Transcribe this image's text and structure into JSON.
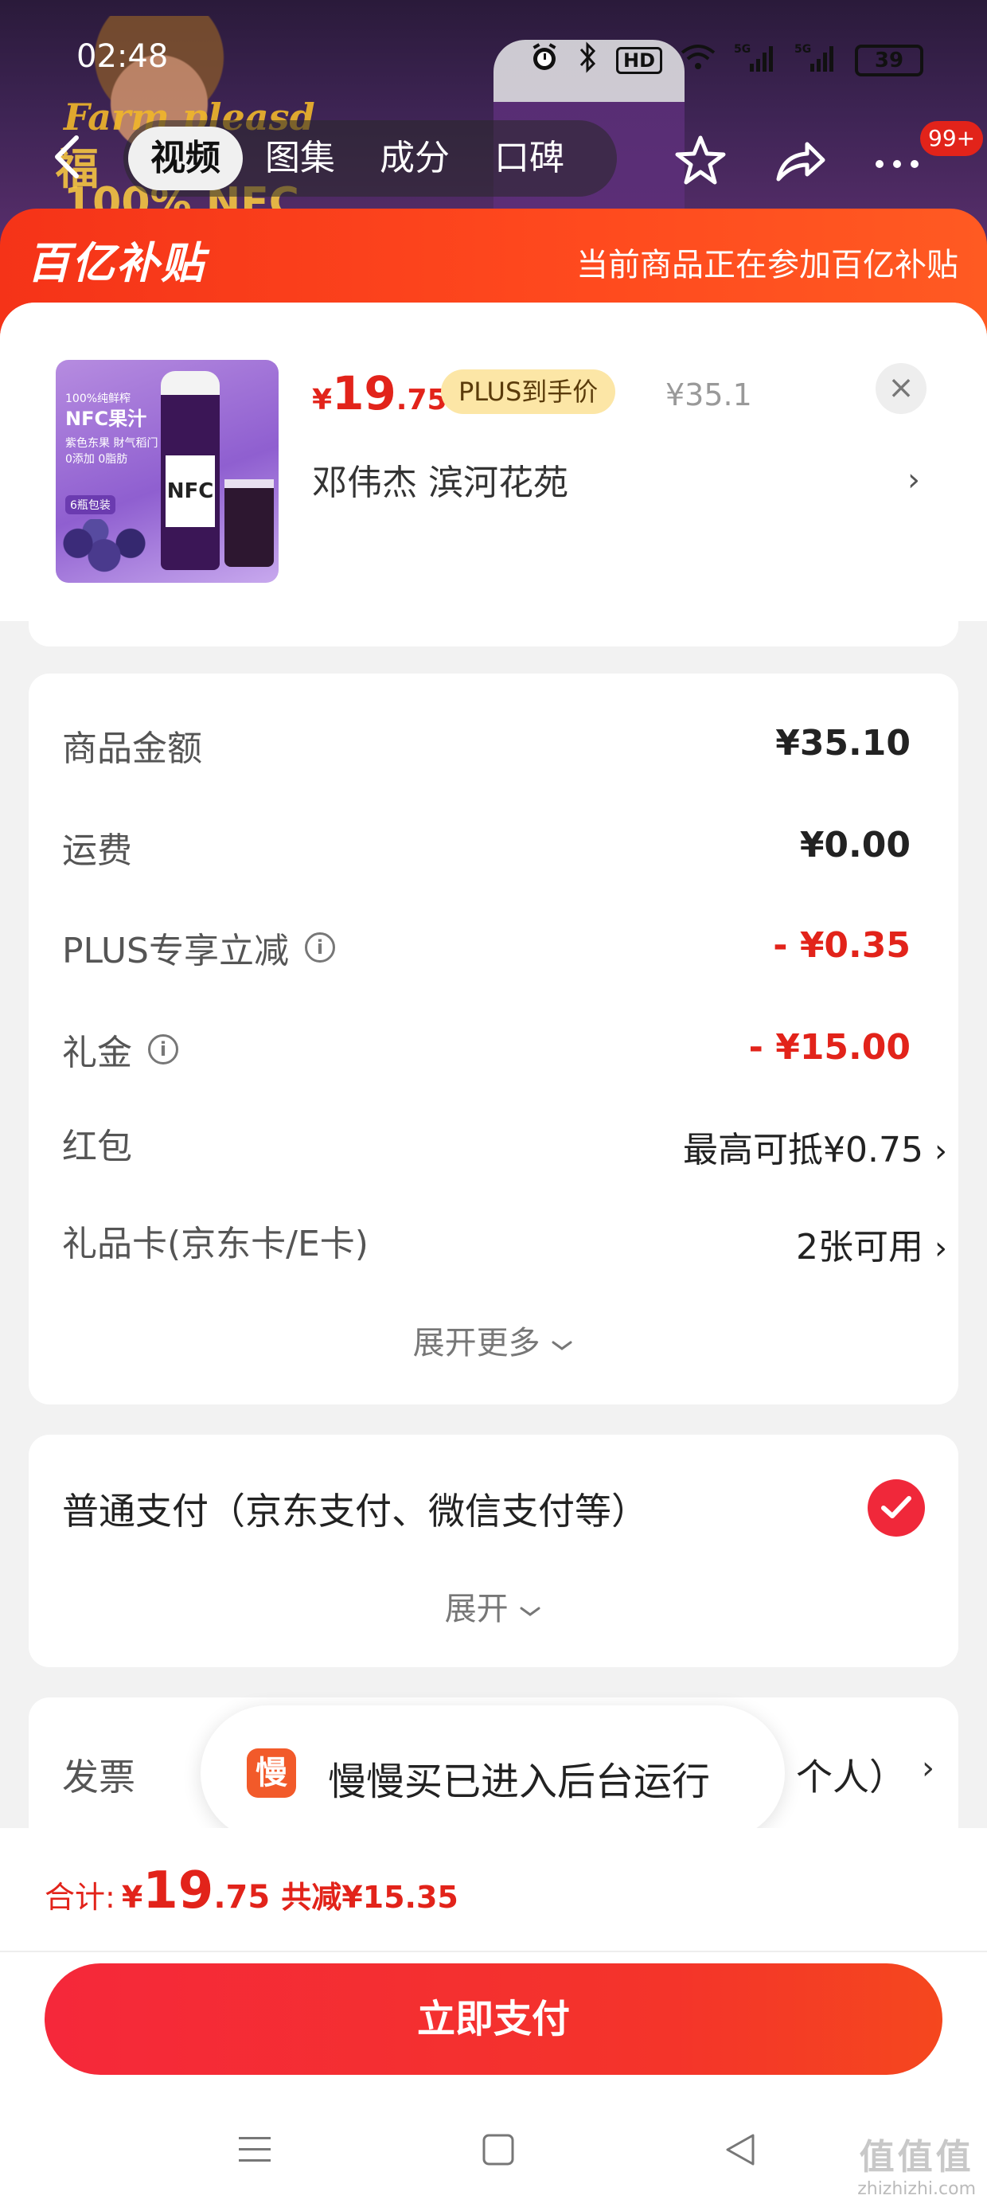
{
  "status_bar": {
    "time": "02:48",
    "hd": "HD",
    "net1": "5G",
    "net2": "5G",
    "battery": "39"
  },
  "backdrop": {
    "brand_line1": "Farm pleasd",
    "brand_line2": "福",
    "brand_line3": "100% NFC"
  },
  "nav": {
    "tabs": [
      {
        "label": "视频",
        "active": true
      },
      {
        "label": "图集",
        "active": false
      },
      {
        "label": "成分",
        "active": false
      },
      {
        "label": "口碑",
        "active": false
      }
    ],
    "badge": "99+"
  },
  "subsidy": {
    "logo": "百亿补贴",
    "note": "当前商品正在参加百亿补贴"
  },
  "product": {
    "thumb_line1": "100%纯鲜榨",
    "thumb_line2": "NFC果汁",
    "thumb_line3": "紫色东果 財气稻门",
    "thumb_line4": "0添加 0脂肪",
    "thumb_pack": "6瓶包装",
    "thumb_label": "NFC",
    "price_yen": "¥",
    "price_int": "19",
    "price_dec": ".75",
    "plus_tag": "PLUS到手价",
    "original_price": "¥35.1",
    "address": "邓伟杰  滨河花苑",
    "close": "×",
    "chevron": "›"
  },
  "cost": {
    "rows": [
      {
        "label": "商品金额",
        "value": "¥35.10"
      },
      {
        "label": "运费",
        "value": "¥0.00"
      },
      {
        "label": "PLUS专享立减",
        "value": "- ¥0.35"
      },
      {
        "label": "礼金",
        "value": "- ¥15.00"
      },
      {
        "label": "红包",
        "value": "最高可抵¥0.75"
      },
      {
        "label": "礼品卡(京东卡/E卡)",
        "value": "2张可用"
      }
    ],
    "info_symbol": "i",
    "expand_more": "展开更多",
    "chevron": "›"
  },
  "payment": {
    "label": "普通支付（京东支付、微信支付等）",
    "expand": "展开"
  },
  "invoice": {
    "label": "发票",
    "value": "个人）"
  },
  "toast": {
    "icon_char": "慢",
    "text": "慢慢买已进入后台运行"
  },
  "bottom": {
    "total_label": "合计:",
    "total_yen": "¥",
    "total_int": "19",
    "total_dec": ".75",
    "saved": "共减¥15.35",
    "pay_button": "立即支付"
  },
  "watermark": {
    "mark": "值值值",
    "site": "zhizhizhi.com"
  },
  "colors": {
    "accent_red": "#e2231a",
    "banner_orange": "#f53318",
    "plus_gold": "#fce6a6"
  }
}
